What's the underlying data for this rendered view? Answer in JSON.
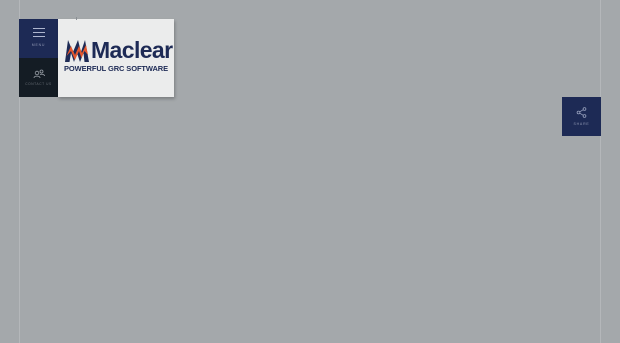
{
  "nav": {
    "menu_label": "MENU",
    "contact_label": "CONTACT US"
  },
  "logo": {
    "name": "Maclear",
    "tagline": "POWERFUL GRC SOFTWARE"
  },
  "share": {
    "label": "SHARE"
  },
  "icons": {
    "menu": "hamburger-icon",
    "contact": "people-icon",
    "share": "share-icon"
  },
  "colors": {
    "navy": "#1d2a55",
    "dark": "#141c24",
    "logo_orange": "#e4572e",
    "overlay": "#a4a8ab"
  }
}
